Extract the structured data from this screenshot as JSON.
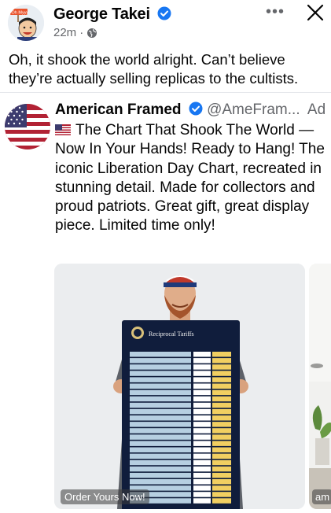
{
  "post": {
    "author": "George Takei",
    "avatar_sign_text": "Oh Myyy",
    "time": "22m",
    "text": "Oh, it shook the world alright. Can’t believe they’re actually selling replicas to the cultists."
  },
  "ad": {
    "page_name": "American Framed",
    "handle": "@AmeFram...",
    "label": "Ad",
    "text": "The Chart That Shook The World — Now In Your Hands! Ready to Hang! The iconic Liberation Day Chart, recreated in stunning detail. Made for collectors and proud patriots. Great gift, great display piece. Limited time only!",
    "chart_title": "Reciprocal Tariffs",
    "cta_primary": "Order Yours Now!",
    "cta_secondary": "am"
  },
  "icons": {
    "verified": "verified-badge-icon",
    "globe": "globe-icon",
    "more": "more-options-icon",
    "close": "close-icon",
    "flag": "us-flag-icon"
  },
  "colors": {
    "verified_blue": "#1877f2",
    "secondary_text": "#65676b",
    "board_navy": "#101d3c",
    "table_blue": "#b6cfe1",
    "table_yellow": "#f1cf61"
  }
}
